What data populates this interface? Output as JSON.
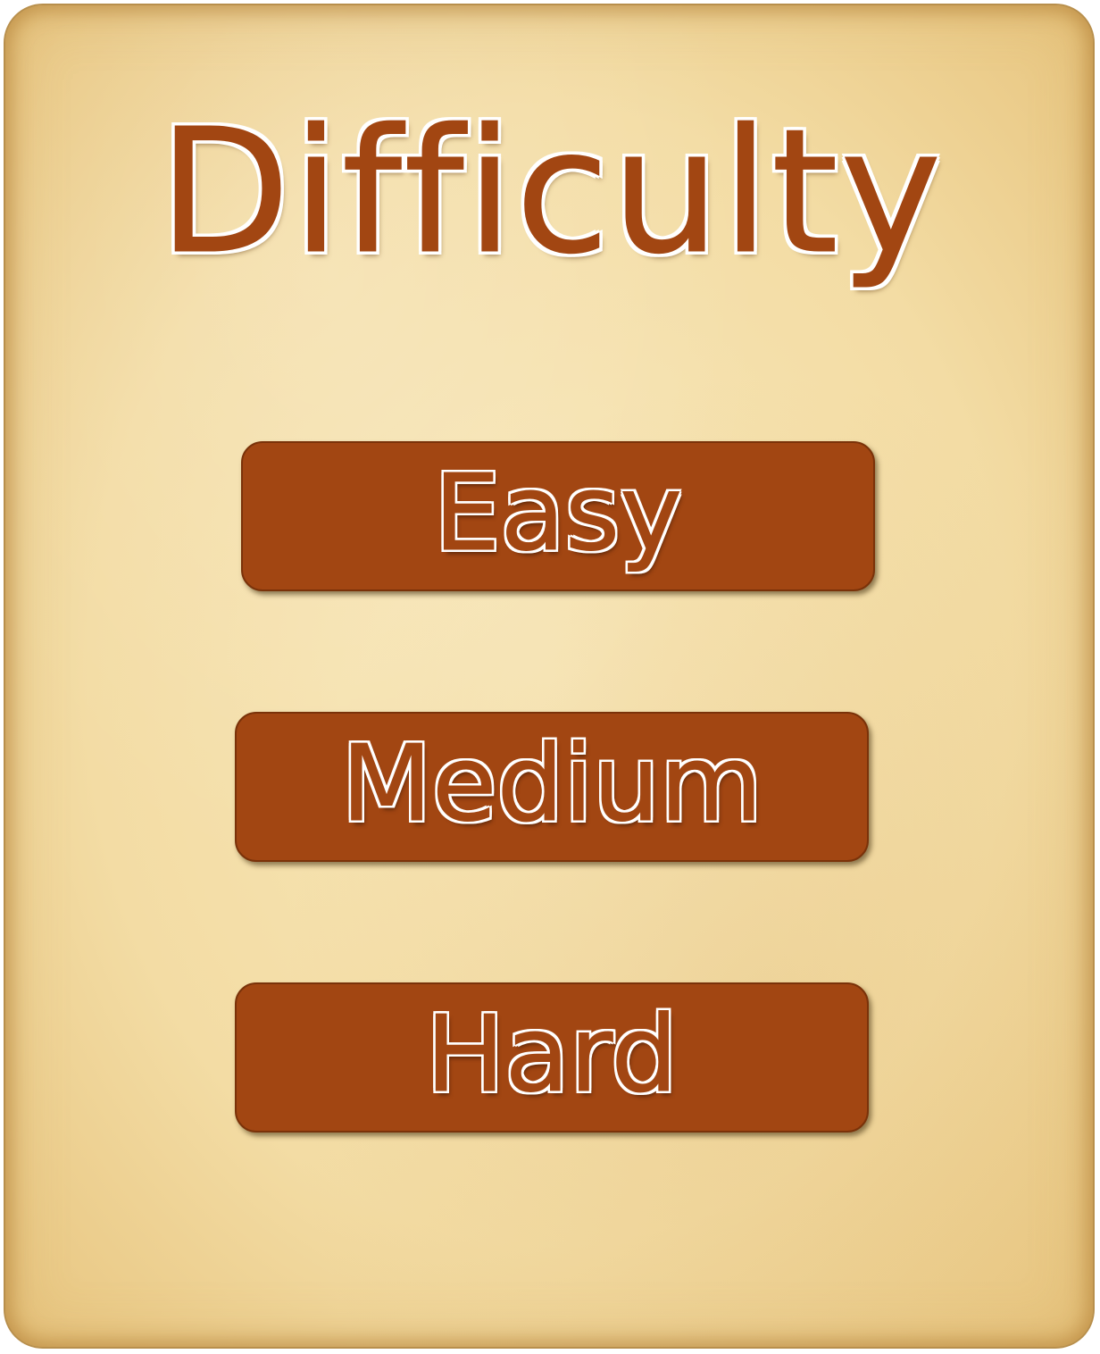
{
  "screen": {
    "title": "Difficulty"
  },
  "options": [
    {
      "label": "Easy"
    },
    {
      "label": "Medium"
    },
    {
      "label": "Hard"
    }
  ],
  "colors": {
    "panel": "#f3dca4",
    "panel_edge": "#e7c47e",
    "accent": "#a24612",
    "outline": "#ffffff"
  }
}
